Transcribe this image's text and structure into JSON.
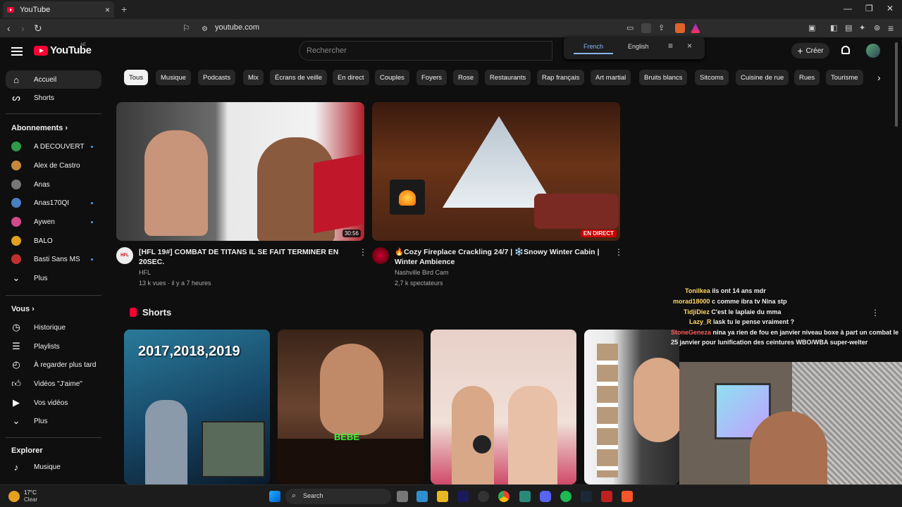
{
  "browser": {
    "tab_title": "YouTube",
    "tab_close": "×",
    "new_tab": "+",
    "url": "youtube.com",
    "window": {
      "minimize": "—",
      "maximize": "❐",
      "close": "✕"
    }
  },
  "translate_popup": {
    "from": "French",
    "to": "English",
    "close": "×"
  },
  "header": {
    "logo_text": "YouTube",
    "country_code": "AE",
    "search_placeholder": "Rechercher",
    "create_label": "Créer",
    "create_plus": "+"
  },
  "sidebar": {
    "main": [
      {
        "label": "Accueil",
        "icon": "home-icon"
      },
      {
        "label": "Shorts",
        "icon": "shorts-icon"
      }
    ],
    "subscriptions_header": "Abonnements",
    "subscriptions": [
      {
        "label": "A DECOUVERT",
        "color": "#2e9a4a",
        "new": true
      },
      {
        "label": "Alex de Castro",
        "color": "#c4893a",
        "new": false
      },
      {
        "label": "Anas",
        "color": "#777777",
        "new": false
      },
      {
        "label": "Anas170QI",
        "color": "#4a7fc0",
        "new": true
      },
      {
        "label": "Aywen",
        "color": "#d04a8a",
        "new": true
      },
      {
        "label": "BALO",
        "color": "#e0a020",
        "new": false
      },
      {
        "label": "Basti Sans MS",
        "color": "#c03030",
        "new": true
      }
    ],
    "subs_more": "Plus",
    "you_header": "Vous",
    "you": [
      {
        "label": "Historique",
        "icon": "history-icon"
      },
      {
        "label": "Playlists",
        "icon": "playlists-icon"
      },
      {
        "label": "À regarder plus tard",
        "icon": "watch-later-icon"
      },
      {
        "label": "Vidéos \"J'aime\"",
        "icon": "like-icon"
      },
      {
        "label": "Vos vidéos",
        "icon": "your-videos-icon"
      },
      {
        "label": "Plus",
        "icon": "chevron-down-icon"
      }
    ],
    "explore_header": "Explorer",
    "explore": [
      {
        "label": "Musique",
        "icon": "music-icon"
      }
    ]
  },
  "chips": [
    "Tous",
    "Musique",
    "Podcasts",
    "Mix",
    "Écrans de veille",
    "En direct",
    "Couples",
    "Foyers",
    "Rose",
    "Restaurants",
    "Rap français",
    "Art martial",
    "Bruits blancs",
    "Sitcoms",
    "Cuisine de rue",
    "Rues",
    "Tourisme"
  ],
  "videos": [
    {
      "title": "[HFL 19#] COMBAT DE TITANS IL SE FAIT TERMINER EN 20SEC.",
      "channel": "HFL",
      "meta": "13 k vues · il y a 7 heures",
      "duration": "30:56",
      "avatar_text": "HFL"
    },
    {
      "title": "🔥Cozy Fireplace Crackling 24/7 | ❄️Snowy Winter Cabin | Winter Ambience",
      "channel": "Nashville Bird Cam",
      "meta": "2,7 k spectateurs",
      "badge": "EN DIRECT"
    }
  ],
  "shorts": {
    "title": "Shorts",
    "items": [
      {
        "overlay": "2017,2018,2019"
      },
      {
        "overlay": "BÉBÉ"
      },
      {
        "overlay": ""
      },
      {
        "overlay": ""
      }
    ]
  },
  "chat": [
    {
      "name": "Tonilkea",
      "msg": "ils ont 14 ans mdr"
    },
    {
      "name": "morad18000",
      "msg": "c comme ibra tv Nina stp"
    },
    {
      "name": "TidjiDiez",
      "msg": "C'est le laplaie du mma"
    },
    {
      "name": "Lazy_R",
      "msg": "lask tu le pense vraiment ?"
    },
    {
      "name": "StoneGeneza",
      "msg": "nina ya rien de fou en janvier niveau boxe à part un combat le 25 janvier pour lunification des ceintures WBO/WBA super-welter"
    }
  ],
  "taskbar": {
    "temp": "17°C",
    "weather": "Clear",
    "search": "Search"
  }
}
